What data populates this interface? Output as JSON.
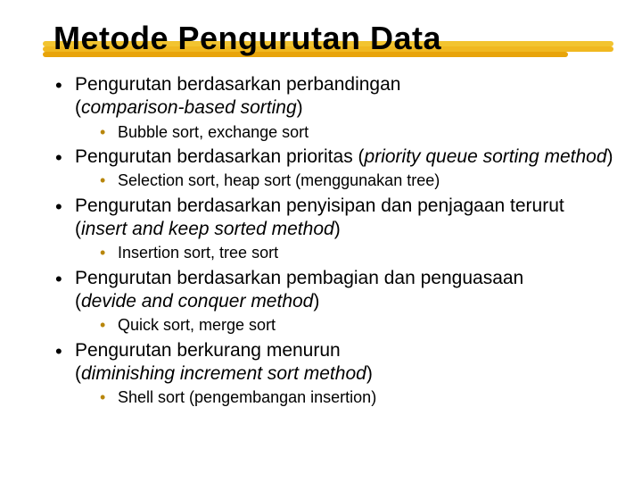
{
  "title": "Metode Pengurutan Data",
  "items": [
    {
      "lead": "Pengurutan berdasarkan perbandingan (",
      "em": "comparison-based sorting",
      "tail": ")",
      "sub_pre": "",
      "sub_hl": "Bubble sort",
      "sub_post": ", exchange sort"
    },
    {
      "lead": "Pengurutan berdasarkan prioritas (",
      "em": "priority queue sorting method",
      "tail": ")",
      "sub_pre": "",
      "sub_hl": "Selection sort",
      "sub_post": ", heap sort (menggunakan tree)"
    },
    {
      "lead": "Pengurutan berdasarkan penyisipan dan penjagaan terurut (",
      "em": "insert and keep sorted method",
      "tail": ")",
      "sub_pre": "",
      "sub_hl": "Insertion sort",
      "sub_post": ", tree sort"
    },
    {
      "lead": "Pengurutan berdasarkan pembagian dan penguasaan (",
      "em": "devide and conquer method",
      "tail": ")",
      "sub_pre": "",
      "sub_hl": "Quick sort",
      "sub_post": ", merge sort"
    },
    {
      "lead": "Pengurutan berkurang menurun (",
      "em": "diminishing increment sort method",
      "tail": ")",
      "sub_pre": "",
      "sub_hl": "Shell sort",
      "sub_post": " (pengembangan insertion)"
    }
  ]
}
